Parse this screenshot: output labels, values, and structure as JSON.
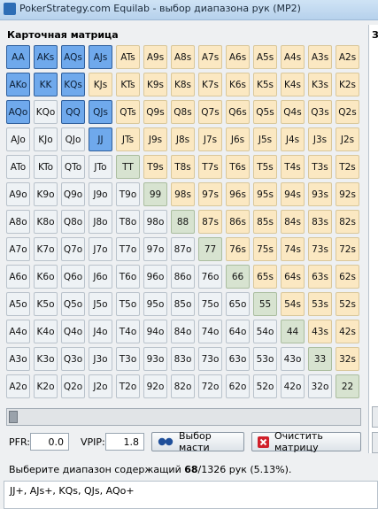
{
  "window": {
    "title": "PokerStrategy.com Equilab - выбор диапазона рук (MP2)"
  },
  "matrix": {
    "title": "Карточная матрица",
    "rows": [
      [
        "AA",
        "AKs",
        "AQs",
        "AJs",
        "ATs",
        "A9s",
        "A8s",
        "A7s",
        "A6s",
        "A5s",
        "A4s",
        "A3s",
        "A2s"
      ],
      [
        "AKo",
        "KK",
        "KQs",
        "KJs",
        "KTs",
        "K9s",
        "K8s",
        "K7s",
        "K6s",
        "K5s",
        "K4s",
        "K3s",
        "K2s"
      ],
      [
        "AQo",
        "KQo",
        "QQ",
        "QJs",
        "QTs",
        "Q9s",
        "Q8s",
        "Q7s",
        "Q6s",
        "Q5s",
        "Q4s",
        "Q3s",
        "Q2s"
      ],
      [
        "AJo",
        "KJo",
        "QJo",
        "JJ",
        "JTs",
        "J9s",
        "J8s",
        "J7s",
        "J6s",
        "J5s",
        "J4s",
        "J3s",
        "J2s"
      ],
      [
        "ATo",
        "KTo",
        "QTo",
        "JTo",
        "TT",
        "T9s",
        "T8s",
        "T7s",
        "T6s",
        "T5s",
        "T4s",
        "T3s",
        "T2s"
      ],
      [
        "A9o",
        "K9o",
        "Q9o",
        "J9o",
        "T9o",
        "99",
        "98s",
        "97s",
        "96s",
        "95s",
        "94s",
        "93s",
        "92s"
      ],
      [
        "A8o",
        "K8o",
        "Q8o",
        "J8o",
        "T8o",
        "98o",
        "88",
        "87s",
        "86s",
        "85s",
        "84s",
        "83s",
        "82s"
      ],
      [
        "A7o",
        "K7o",
        "Q7o",
        "J7o",
        "T7o",
        "97o",
        "87o",
        "77",
        "76s",
        "75s",
        "74s",
        "73s",
        "72s"
      ],
      [
        "A6o",
        "K6o",
        "Q6o",
        "J6o",
        "T6o",
        "96o",
        "86o",
        "76o",
        "66",
        "65s",
        "64s",
        "63s",
        "62s"
      ],
      [
        "A5o",
        "K5o",
        "Q5o",
        "J5o",
        "T5o",
        "95o",
        "85o",
        "75o",
        "65o",
        "55",
        "54s",
        "53s",
        "52s"
      ],
      [
        "A4o",
        "K4o",
        "Q4o",
        "J4o",
        "T4o",
        "94o",
        "84o",
        "74o",
        "64o",
        "54o",
        "44",
        "43s",
        "42s"
      ],
      [
        "A3o",
        "K3o",
        "Q3o",
        "J3o",
        "T3o",
        "93o",
        "83o",
        "73o",
        "63o",
        "53o",
        "43o",
        "33",
        "32s"
      ],
      [
        "A2o",
        "K2o",
        "Q2o",
        "J2o",
        "T2o",
        "92o",
        "82o",
        "72o",
        "62o",
        "52o",
        "42o",
        "32o",
        "22"
      ]
    ],
    "selected": [
      "AA",
      "AKs",
      "AQs",
      "AJs",
      "AKo",
      "KK",
      "KQs",
      "AQo",
      "QQ",
      "QJs",
      "JJ"
    ]
  },
  "controls": {
    "pfr_label": "PFR:",
    "pfr_value": "0.0",
    "vpip_label": "VPIP:",
    "vpip_value": "1.8",
    "suit_button": "Выбор масти",
    "clear_button": "Очистить матрицу"
  },
  "right_panel": {
    "label": "З"
  },
  "status": {
    "prefix": "Выберите диапазон содержащий ",
    "count": "68",
    "suffix": "/1326 рук (5.13%)."
  },
  "range_text": "JJ+, AJs+, KQs, QJs, AQo+",
  "colors": {
    "selected": "#6fa9ec",
    "suited": "#fbe8c2",
    "pair": "#d7e3d0",
    "offsuit": "#eef2f5"
  },
  "icons": [
    "app-icon",
    "suit-selector-icon",
    "clear-x-icon",
    "scroll-thumb"
  ]
}
